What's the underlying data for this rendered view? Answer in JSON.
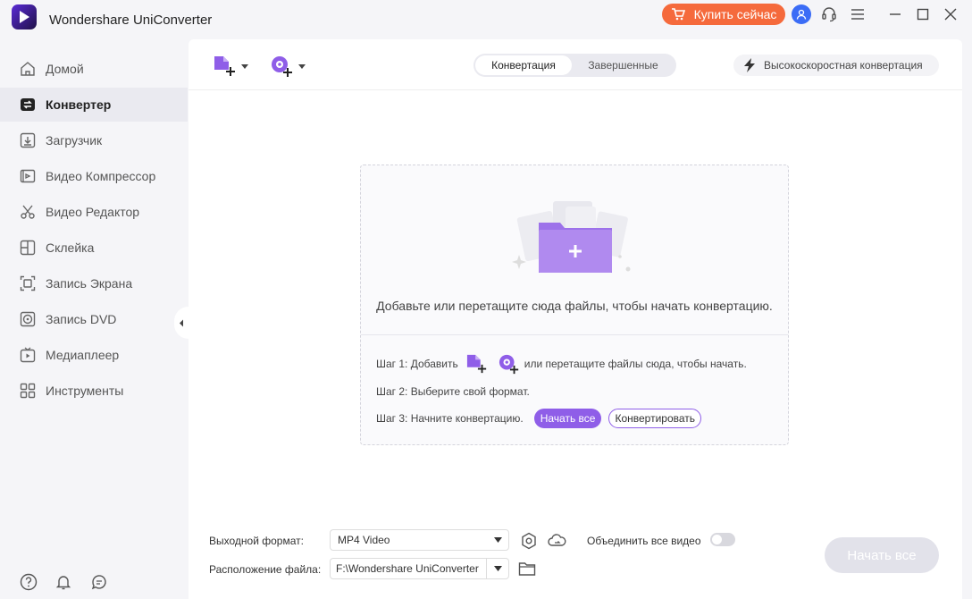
{
  "app": {
    "title": "Wondershare UniConverter"
  },
  "header": {
    "buy_label": "Купить сейчас"
  },
  "sidebar": {
    "items": [
      {
        "label": "Домой",
        "icon": "home-icon"
      },
      {
        "label": "Конвертер",
        "icon": "converter-icon"
      },
      {
        "label": "Загрузчик",
        "icon": "download-icon"
      },
      {
        "label": "Видео Компрессор",
        "icon": "compress-icon"
      },
      {
        "label": "Видео Редактор",
        "icon": "scissors-icon"
      },
      {
        "label": "Склейка",
        "icon": "merge-icon"
      },
      {
        "label": "Запись Экрана",
        "icon": "screen-record-icon"
      },
      {
        "label": "Запись DVD",
        "icon": "dvd-icon"
      },
      {
        "label": "Медиаплеер",
        "icon": "player-icon"
      },
      {
        "label": "Инструменты",
        "icon": "tools-icon"
      }
    ],
    "active": "Конвертер"
  },
  "tabs": {
    "convert": "Конвертация",
    "done": "Завершенные"
  },
  "high_speed": {
    "label": "Высокоскоростная конвертация"
  },
  "dropzone": {
    "message": "Добавьте или перетащите сюда файлы, чтобы начать конвертацию.",
    "step1_prefix": "Шаг 1: Добавить",
    "step1_suffix": "или перетащите файлы сюда, чтобы начать.",
    "step2": "Шаг 2: Выберите свой формат.",
    "step3": "Шаг 3: Начните конвертацию.",
    "start_all_label": "Начать все",
    "convert_label": "Конвертировать"
  },
  "bottom": {
    "output_format_label": "Выходной формат:",
    "output_format_value": "MP4 Video",
    "file_location_label": "Расположение файла:",
    "file_location_value": "F:\\Wondershare UniConverter",
    "merge_label": "Объединить все видео",
    "merge_enabled": false,
    "start_all_label": "Начать все"
  },
  "colors": {
    "accent": "#8f5ee8",
    "buy": "#f56a3c",
    "avatar": "#3b6cf6"
  }
}
